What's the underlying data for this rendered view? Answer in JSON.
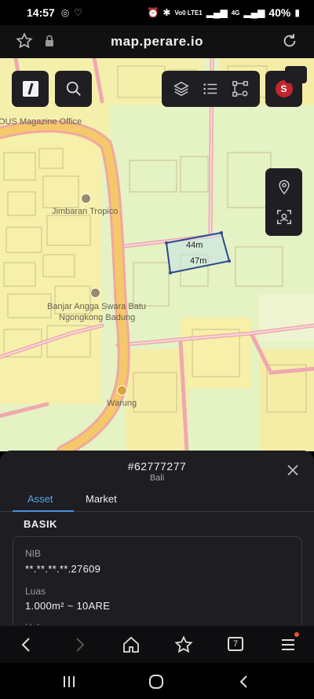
{
  "status_bar": {
    "time": "14:57",
    "network": "Vo0 LTE1",
    "signal2": "4G",
    "battery": "40%"
  },
  "browser": {
    "url": "map.perare.io",
    "tab_count": "7"
  },
  "map": {
    "labels": {
      "magazine_office": "OUS Magazine Office",
      "jimbaran": "Jimbaran Tropico",
      "banjar_line1": "Banjar Angga Swara Batu",
      "banjar_line2": "Ngongkong Badung",
      "warung": "Warung"
    },
    "parcel": {
      "top_dimension": "44m",
      "side_dimension": "47m"
    },
    "user_initial": "S"
  },
  "sheet": {
    "parcel_id": "#62777277",
    "region": "Bali",
    "tabs": [
      "Asset",
      "Market"
    ],
    "active_tab": "Asset",
    "section": "BASIK",
    "fields": [
      {
        "label": "NIB",
        "value": "**.**.**.**.27609"
      },
      {
        "label": "Luas",
        "value": "1.000m² ~ 10ARE"
      },
      {
        "label": "Hak",
        "value": ""
      }
    ]
  },
  "colors": {
    "accent": "#4a90e2",
    "parcel_outline": "#2c4a8a",
    "road": "#f0a8b0",
    "main_road": "#f2c36a"
  }
}
